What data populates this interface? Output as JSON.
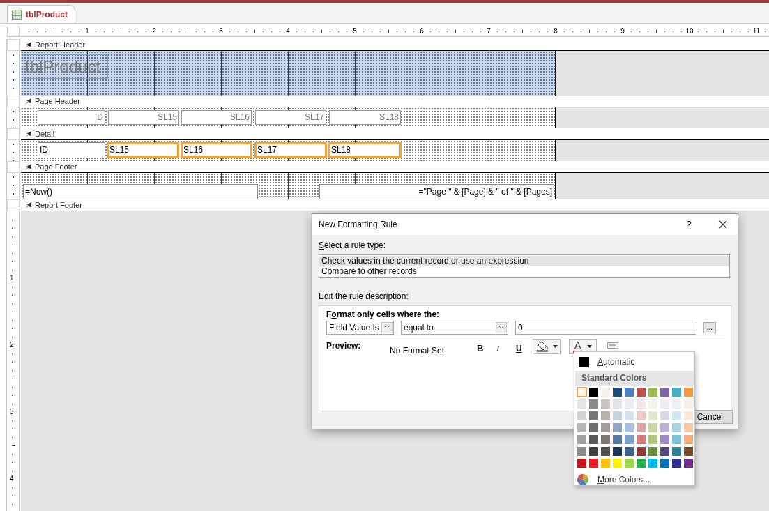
{
  "document_tab": {
    "title": "tblProduct",
    "selected": true
  },
  "ruler": {
    "labels": [
      "1",
      "2",
      "3",
      "4",
      "5",
      "6",
      "7",
      "8",
      "9",
      "10",
      "11"
    ]
  },
  "vertical_ruler": {
    "labels": [
      "1",
      "2",
      "3",
      "4"
    ]
  },
  "sections": [
    {
      "title": "Report Header",
      "highlighted": true,
      "controls": [
        {
          "kind": "title",
          "text": "tblProduct"
        }
      ]
    },
    {
      "title": "Page Header",
      "highlighted": false,
      "controls": [
        {
          "kind": "label",
          "text": "ID"
        },
        {
          "kind": "label",
          "text": "SL15"
        },
        {
          "kind": "label",
          "text": "SL16"
        },
        {
          "kind": "label",
          "text": "SL17"
        },
        {
          "kind": "label",
          "text": "SL18"
        }
      ]
    },
    {
      "title": "Detail",
      "highlighted": false,
      "controls": [
        {
          "kind": "textbox",
          "text": "ID",
          "selected": false
        },
        {
          "kind": "textbox",
          "text": "SL15",
          "selected": true
        },
        {
          "kind": "textbox",
          "text": "SL16",
          "selected": true
        },
        {
          "kind": "textbox",
          "text": "SL17",
          "selected": true
        },
        {
          "kind": "textbox",
          "text": "SL18",
          "selected": true
        }
      ]
    },
    {
      "title": "Page Footer",
      "highlighted": false,
      "controls": [
        {
          "kind": "textbox",
          "text": "=Now()",
          "selected": false
        },
        {
          "kind": "textbox",
          "text": "=\"Page \" & [Page] & \" of \" & [Pages]",
          "selected": false,
          "right_aligned": true
        }
      ]
    },
    {
      "title": "Report Footer"
    }
  ],
  "dialog": {
    "title": "New Formatting Rule",
    "help": "?",
    "rule_type_label": {
      "key": "S",
      "after": "elect a rule type:"
    },
    "rule_types": [
      {
        "text": "Check values in the current record or use an expression",
        "selected": true
      },
      {
        "text": "Compare to other records",
        "selected": false
      }
    ],
    "description_label": "Edit the rule description:",
    "condition_label": {
      "before": "F",
      "key": "o",
      "after": "rmat only cells where the:"
    },
    "field": {
      "value": "Field Value Is"
    },
    "operator": {
      "value": "equal to"
    },
    "value": {
      "value": "0"
    },
    "builder_button": "...",
    "preview_label": "Preview:",
    "preview_sample": "No Format Set",
    "format_tools": [
      {
        "kind": "bold",
        "text": "B"
      },
      {
        "kind": "italic",
        "text": "I"
      },
      {
        "kind": "underline",
        "text": "U"
      },
      {
        "kind": "fill"
      },
      {
        "kind": "font-color",
        "text": "A"
      },
      {
        "kind": "toggle"
      }
    ],
    "buttons": [
      "Cancel"
    ]
  },
  "color_menu": {
    "automatic": {
      "key": "A",
      "after": "utomatic"
    },
    "header": "Standard Colors",
    "rows": [
      {
        "swatches": [
          {
            "color": "#ffffff",
            "selected": true
          },
          {
            "color": "#000000",
            "selected": false
          },
          {
            "color": "#f6f2e8",
            "selected": false
          },
          {
            "color": "#1f497d",
            "selected": false
          },
          {
            "color": "#4f81bd",
            "selected": false
          },
          {
            "color": "#c0504d",
            "selected": false
          },
          {
            "color": "#9bbb59",
            "selected": false
          },
          {
            "color": "#8064a2",
            "selected": false
          },
          {
            "color": "#4bacc6",
            "selected": false
          },
          {
            "color": "#f79646",
            "selected": false
          }
        ]
      },
      {
        "swatches": [
          {
            "color": "#e6e6e6",
            "selected": false
          },
          {
            "color": "#898989",
            "selected": false
          },
          {
            "color": "#c9c5bd",
            "selected": false
          },
          {
            "color": "#dfe5ee",
            "selected": false
          },
          {
            "color": "#e9eef6",
            "selected": false
          },
          {
            "color": "#f6e6e6",
            "selected": false
          },
          {
            "color": "#f4f5ea",
            "selected": false
          },
          {
            "color": "#eeedf2",
            "selected": false
          },
          {
            "color": "#e8f1f5",
            "selected": false
          },
          {
            "color": "#f8efe4",
            "selected": false
          }
        ]
      },
      {
        "swatches": [
          {
            "color": "#d3d3d3",
            "selected": false
          },
          {
            "color": "#767676",
            "selected": false
          },
          {
            "color": "#bab2a8",
            "selected": false
          },
          {
            "color": "#c5d2df",
            "selected": false
          },
          {
            "color": "#d6e0ee",
            "selected": false
          },
          {
            "color": "#f0c9c9",
            "selected": false
          },
          {
            "color": "#e0e9d0",
            "selected": false
          },
          {
            "color": "#dcd9e6",
            "selected": false
          },
          {
            "color": "#d1e8ee",
            "selected": false
          },
          {
            "color": "#fbe6d6",
            "selected": false
          }
        ]
      },
      {
        "swatches": [
          {
            "color": "#b6b6b6",
            "selected": false
          },
          {
            "color": "#6d6d6d",
            "selected": false
          },
          {
            "color": "#a39e98",
            "selected": false
          },
          {
            "color": "#8fa6c4",
            "selected": false
          },
          {
            "color": "#a8bfdf",
            "selected": false
          },
          {
            "color": "#e0a4a6",
            "selected": false
          },
          {
            "color": "#c8d8a7",
            "selected": false
          },
          {
            "color": "#bfb0d4",
            "selected": false
          },
          {
            "color": "#a8d5e2",
            "selected": false
          },
          {
            "color": "#f9c9a4",
            "selected": false
          }
        ]
      },
      {
        "swatches": [
          {
            "color": "#a1a1a1",
            "selected": false
          },
          {
            "color": "#595959",
            "selected": false
          },
          {
            "color": "#7c7770",
            "selected": false
          },
          {
            "color": "#5577a0",
            "selected": false
          },
          {
            "color": "#7f9fcf",
            "selected": false
          },
          {
            "color": "#d57b7b",
            "selected": false
          },
          {
            "color": "#adc781",
            "selected": false
          },
          {
            "color": "#a18bc0",
            "selected": false
          },
          {
            "color": "#7fc1d5",
            "selected": false
          },
          {
            "color": "#f7ad7b",
            "selected": false
          }
        ]
      },
      {
        "swatches": [
          {
            "color": "#8c8c8c",
            "selected": false
          },
          {
            "color": "#3f3f3f",
            "selected": false
          },
          {
            "color": "#535049",
            "selected": false
          },
          {
            "color": "#193557",
            "selected": false
          },
          {
            "color": "#3e5e8c",
            "selected": false
          },
          {
            "color": "#913a37",
            "selected": false
          },
          {
            "color": "#6a8b3e",
            "selected": false
          },
          {
            "color": "#5b467a",
            "selected": false
          },
          {
            "color": "#308193",
            "selected": false
          },
          {
            "color": "#7a4a27",
            "selected": false
          }
        ]
      },
      {
        "swatches": [
          {
            "color": "#c0151b",
            "selected": false
          },
          {
            "color": "#ed1c24",
            "selected": false
          },
          {
            "color": "#ffc20e",
            "selected": false
          },
          {
            "color": "#fff200",
            "selected": false
          },
          {
            "color": "#a0d746",
            "selected": false
          },
          {
            "color": "#22b14c",
            "selected": false
          },
          {
            "color": "#00b7ef",
            "selected": false
          },
          {
            "color": "#0072bc",
            "selected": false
          },
          {
            "color": "#2e3192",
            "selected": false
          },
          {
            "color": "#6f2c91",
            "selected": false
          }
        ]
      }
    ],
    "more": {
      "key": "M",
      "after": "ore Colors..."
    }
  }
}
